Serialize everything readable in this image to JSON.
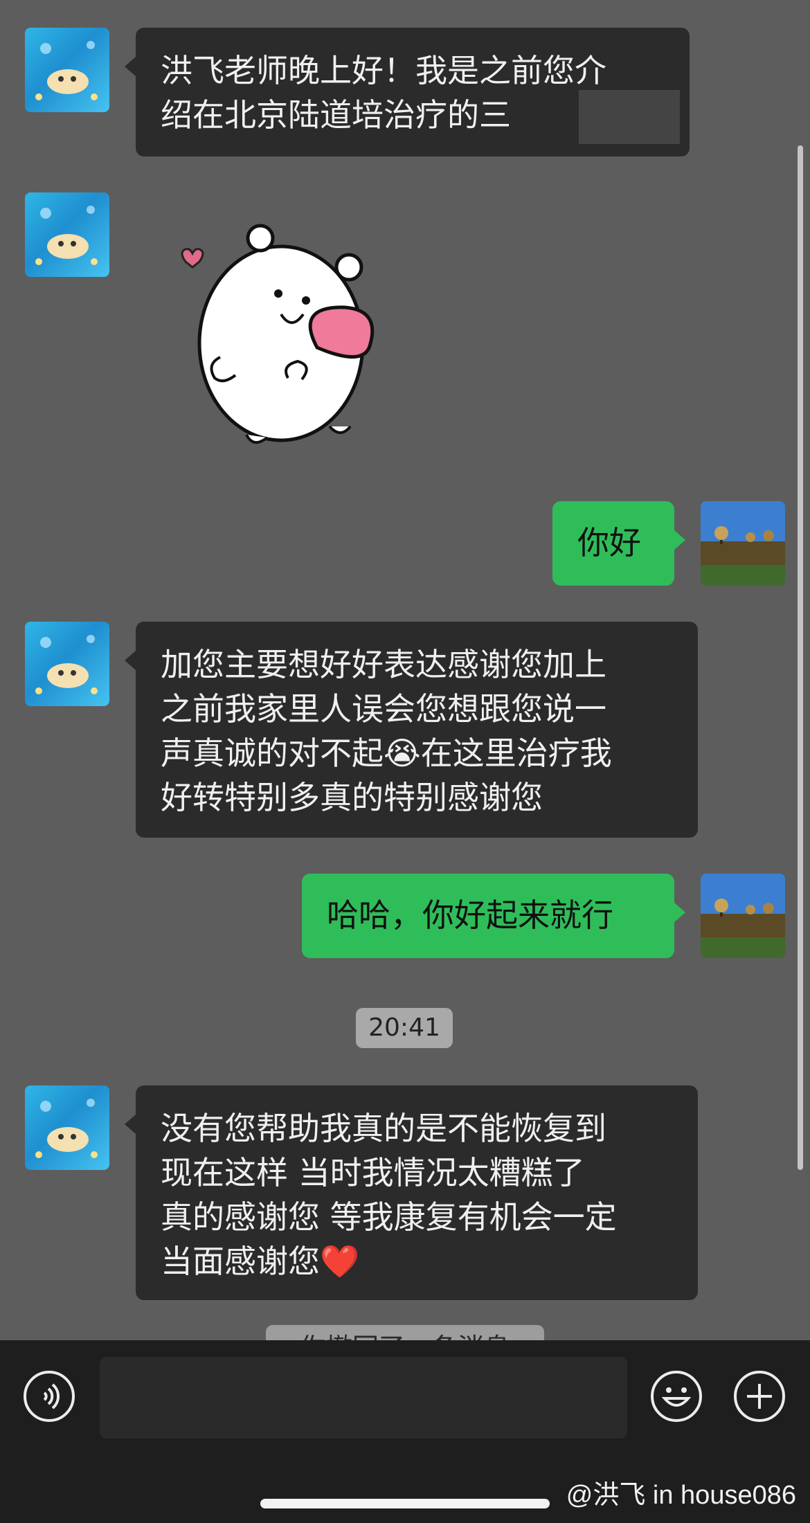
{
  "messages": {
    "m1_lines": [
      "洪飞老师晚上好！我是之前您介",
      "绍在北京陆道培治疗的三"
    ],
    "m3": "你好",
    "m4_lines": [
      "加您主要想好好表达感谢您加上",
      "之前我家里人误会您想跟您说一",
      "声真诚的对不起😭在这里治疗我",
      "好转特别多真的特别感谢您"
    ],
    "m5": "哈哈，你好起来就行",
    "timestamp": "20:41",
    "m6_lines": [
      "没有您帮助我真的是不能恢复到",
      "现在这样 当时我情况太糟糕了",
      "真的感谢您 等我康复有机会一定",
      "当面感谢您❤️"
    ],
    "partial_notice": "你撤回了一条消息"
  },
  "input": {
    "voice_icon": "voice-icon",
    "emoji_icon": "emoji-icon",
    "add_icon": "plus-icon"
  },
  "watermark": "@洪飞 in house086",
  "colors": {
    "background": "#5d5d5d",
    "incoming_bubble": "#2b2b2b",
    "outgoing_bubble": "#2fbd5a"
  }
}
